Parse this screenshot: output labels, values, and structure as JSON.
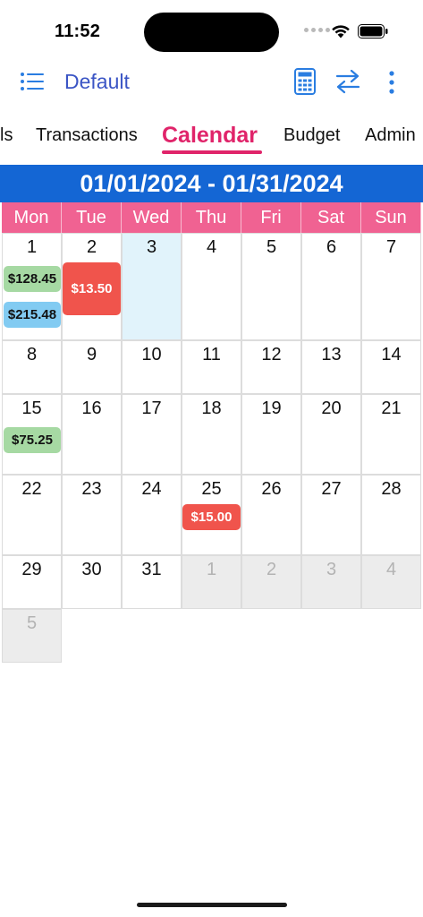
{
  "status_bar": {
    "time": "11:52"
  },
  "toolbar": {
    "title": "Default"
  },
  "tabs": [
    {
      "label": "ls"
    },
    {
      "label": "Transactions"
    },
    {
      "label": "Calendar"
    },
    {
      "label": "Budget"
    },
    {
      "label": "Admin"
    }
  ],
  "active_tab": "Calendar",
  "calendar": {
    "range": "01/01/2024 - 01/31/2024",
    "weekdays": [
      "Mon",
      "Tue",
      "Wed",
      "Thu",
      "Fri",
      "Sat",
      "Sun"
    ],
    "weeks": [
      [
        "1",
        "2",
        "3",
        "4",
        "5",
        "6",
        "7"
      ],
      [
        "8",
        "9",
        "10",
        "11",
        "12",
        "13",
        "14"
      ],
      [
        "15",
        "16",
        "17",
        "18",
        "19",
        "20",
        "21"
      ],
      [
        "22",
        "23",
        "24",
        "25",
        "26",
        "27",
        "28"
      ],
      [
        "29",
        "30",
        "31",
        "1",
        "2",
        "3",
        "4"
      ],
      [
        "5"
      ]
    ],
    "selected_day": "3",
    "entries": [
      {
        "amount": "$128.45",
        "color": "#a6d9a3",
        "day": "1"
      },
      {
        "amount": "$215.48",
        "color": "#82cbf2",
        "day": "1"
      },
      {
        "amount": "$13.50",
        "color": "#f0544c",
        "day": "2"
      },
      {
        "amount": "$75.25",
        "color": "#a6d9a3",
        "day": "15"
      },
      {
        "amount": "$15.00",
        "color": "#f0544c",
        "day": "25"
      }
    ]
  },
  "colors": {
    "accent": "#e0246a",
    "banner": "#1466d4",
    "weekday_header": "#f06292",
    "toolbar_tint": "#3b55c5"
  }
}
